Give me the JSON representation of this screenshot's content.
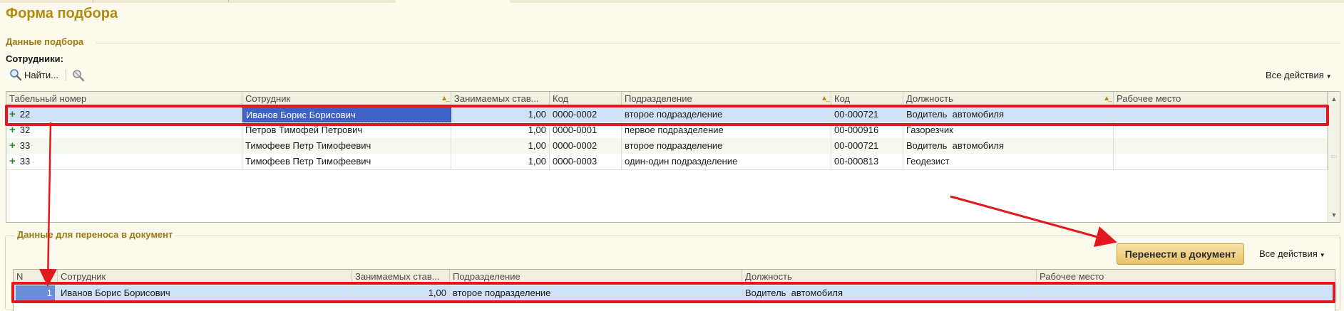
{
  "title": "Форма подбора",
  "selection": {
    "section_title": "Данные подбора",
    "employees_label": "Сотрудники:",
    "find_label": "Найти...",
    "all_actions": "Все действия",
    "columns": [
      "Табельный номер",
      "Сотрудник",
      "Занимаемых став...",
      "Код",
      "Подразделение",
      "Код",
      "Должность",
      "Рабочее место"
    ],
    "rows": [
      {
        "tab_no": "22",
        "employee": "Иванов Борис Борисович",
        "rate": "1,00",
        "code": "0000-0002",
        "department": "второе подразделение",
        "code2": "00-000721",
        "position": "Водитель  автомобиля",
        "workplace": ""
      },
      {
        "tab_no": "32",
        "employee": "Петров Тимофей Петрович",
        "rate": "1,00",
        "code": "0000-0001",
        "department": "первое подразделение",
        "code2": "00-000916",
        "position": "Газорезчик",
        "workplace": ""
      },
      {
        "tab_no": "33",
        "employee": "Тимофеев Петр Тимофеевич",
        "rate": "1,00",
        "code": "0000-0002",
        "department": "второе подразделение",
        "code2": "00-000721",
        "position": "Водитель  автомобиля",
        "workplace": ""
      },
      {
        "tab_no": "33",
        "employee": "Тимофеев Петр Тимофеевич",
        "rate": "1,00",
        "code": "0000-0003",
        "department": "один-один подразделение",
        "code2": "00-000813",
        "position": "Геодезист",
        "workplace": ""
      }
    ]
  },
  "transfer": {
    "section_title": "Данные для переноса в документ",
    "transfer_button": "Перенести в документ",
    "all_actions": "Все действия",
    "columns": [
      "N",
      "Сотрудник",
      "Занимаемых став...",
      "Подразделение",
      "Должность",
      "Рабочее место"
    ],
    "rows": [
      {
        "n": "1",
        "employee": "Иванов Борис Борисович",
        "rate": "1,00",
        "department": "второе подразделение",
        "position": "Водитель  автомобиля",
        "workplace": ""
      }
    ]
  },
  "colors": {
    "accent": "#b38a0b",
    "highlight": "#cfe2f7",
    "selected_cell": "#3a5fcd",
    "annotation": "#e3181e"
  }
}
